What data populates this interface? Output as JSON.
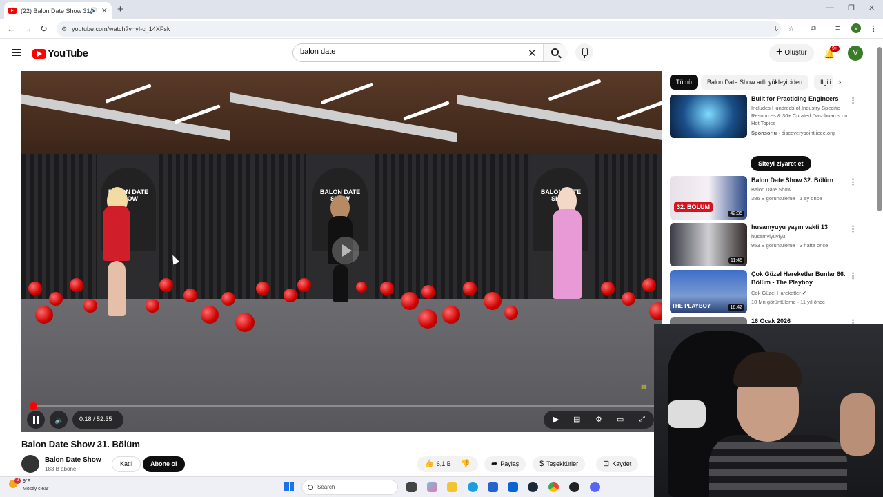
{
  "browser": {
    "tab_title": "(22) Balon Date Show 31. B",
    "url": "youtube.com/watch?v=yI-c_14XFsk",
    "profile_initial": "V"
  },
  "header": {
    "logo_text": "YouTube",
    "search_value": "balon date",
    "create_label": "Oluştur",
    "notification_count": "9+",
    "avatar_initial": "V"
  },
  "player": {
    "sign_text": "BALON DATE SHOW",
    "time_display": "0:18 / 52:35",
    "progress_fraction": 0.006
  },
  "video": {
    "title": "Balon Date Show 31. Bölüm",
    "channel": "Balon Date Show",
    "subscribers": "183 B abone",
    "join_label": "Katıl",
    "subscribe_label": "Abone ol",
    "likes": "6,1 B",
    "share_label": "Paylaş",
    "thanks_label": "Teşekkürler",
    "save_label": "Kaydet"
  },
  "sidebar": {
    "chips": [
      "Tümü",
      "Balon Date Show adlı yükleyiciden",
      "İlgili"
    ],
    "ad": {
      "title": "Built for Practicing Engineers",
      "desc": "Includes Hundreds of Industry-Specific Resources & 30+ Curated Dashboards on Hot Topics",
      "sponsor": "Sponsorlu",
      "domain": "discoverypoint.ieee.org",
      "cta": "Siteyi ziyaret et"
    },
    "recs": [
      {
        "title": "Balon Date Show 32. Bölüm",
        "channel": "Balon Date Show",
        "meta": "386 B görüntüleme · 1 ay önce",
        "duration": "42:35",
        "badge": "32. BÖLÜM"
      },
      {
        "title": "husamyuyu yayın vakti 13",
        "channel": "husamviyuviyu",
        "meta": "953 B görüntüleme · 3 hafta önce",
        "duration": "11:45"
      },
      {
        "title": "Çok Güzel Hareketler Bunlar 66. Bölüm - The Playboy",
        "channel": "Çok Güzel Hareketler",
        "meta": "10 Mn görüntüleme · 11 yıl önce",
        "duration": "16:42",
        "badge": "THE PLAYBOY"
      },
      {
        "title": "16 Ocak 2026"
      }
    ]
  },
  "taskbar": {
    "weather_badge": "2",
    "temp": "9°F",
    "weather_text": "Mostly clear",
    "search_label": "Search"
  },
  "colors": {
    "accent": "#ff0000",
    "subscribe_bg": "#0f0f0f"
  }
}
